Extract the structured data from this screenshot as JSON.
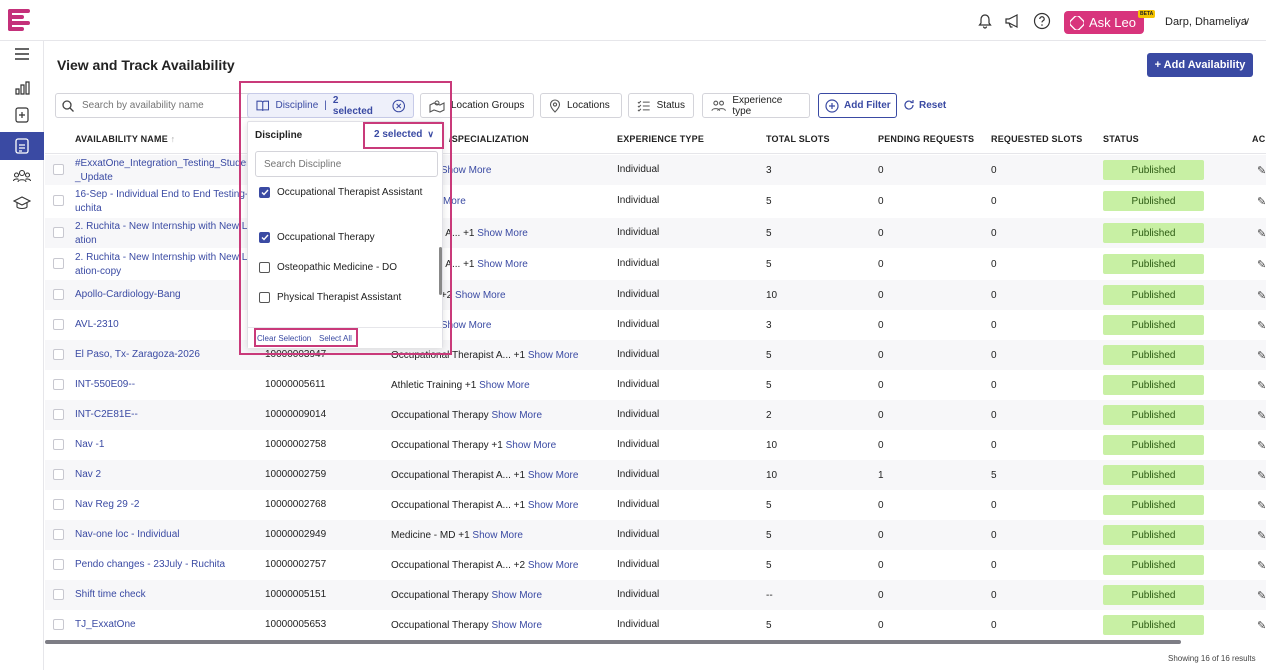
{
  "topbar": {
    "ask_leo_label": "Ask Leo",
    "beta_badge": "BETA",
    "user_name": "Darp, Dhameliya",
    "icons": [
      "bell-icon",
      "megaphone-icon",
      "help-icon"
    ]
  },
  "sidebar": {
    "items": [
      "menu-icon",
      "reports-icon",
      "add-document-icon",
      "availability-icon",
      "users-icon",
      "graduation-icon"
    ],
    "active_index": 3
  },
  "page": {
    "title": "View and Track Availability",
    "add_button": "+ Add Availability"
  },
  "filters": {
    "search_placeholder": "Search by availability name",
    "discipline_label": "Discipline",
    "discipline_count": "2 selected",
    "location_groups": "Location Groups",
    "locations": "Locations",
    "status": "Status",
    "experience_type": "Experience type",
    "add_filter": "Add Filter",
    "reset": "Reset"
  },
  "dropdown": {
    "title": "Discipline",
    "selected_label": "2 selected",
    "search_placeholder": "Search Discipline",
    "options": [
      {
        "label": "Occupational Therapist Assistant",
        "checked": true
      },
      {
        "label": "Occupational Therapy",
        "checked": true
      },
      {
        "label": "Osteopathic Medicine - DO",
        "checked": false
      },
      {
        "label": "Physical Therapist Assistant",
        "checked": false
      }
    ],
    "clear_selection": "Clear Selection",
    "select_all": "Select All"
  },
  "table": {
    "headers": {
      "name": "AVAILABILITY NAME",
      "discipline": "/SPECIALIZATION",
      "experience": "EXPERIENCE TYPE",
      "total_slots": "TOTAL SLOTS",
      "pending": "PENDING REQUESTS",
      "requested": "REQUESTED SLOTS",
      "status": "STATUS",
      "actions": "AC"
    },
    "rows": [
      {
        "name": "#ExxatOne_Integration_Testing_Studen\n_Update",
        "id": "",
        "discipline": "al Therapy",
        "more": "Show More",
        "experience": "Individual",
        "total": "3",
        "pending": "0",
        "requested": "0",
        "status": "Published"
      },
      {
        "name": "16-Sep - Individual End to End Testing-\nuchita",
        "id": "",
        "discipline": "D +2",
        "more": "Show More",
        "experience": "Individual",
        "total": "5",
        "pending": "0",
        "requested": "0",
        "status": "Published"
      },
      {
        "name": "2. Ruchita - New Internship with New Lo\nation",
        "id": "",
        "discipline": "al Therapist A... +1",
        "more": "Show More",
        "experience": "Individual",
        "total": "5",
        "pending": "0",
        "requested": "0",
        "status": "Published"
      },
      {
        "name": "2. Ruchita - New Internship with New Lo\nation-copy",
        "id": "",
        "discipline": "al Therapist A... +1",
        "more": "Show More",
        "experience": "Individual",
        "total": "5",
        "pending": "0",
        "requested": "0",
        "status": "Published"
      },
      {
        "name": "Apollo-Cardiology-Bang",
        "id": "",
        "discipline": "al Therapy +2",
        "more": "Show More",
        "experience": "Individual",
        "total": "10",
        "pending": "0",
        "requested": "0",
        "status": "Published"
      },
      {
        "name": "AVL-2310",
        "id": "",
        "discipline": "al Therapy",
        "more": "Show More",
        "experience": "Individual",
        "total": "3",
        "pending": "0",
        "requested": "0",
        "status": "Published"
      },
      {
        "name": "El Paso, Tx- Zaragoza-2026",
        "id": "10000003947",
        "discipline": "Occupational Therapist A... +1",
        "more": "Show More",
        "experience": "Individual",
        "total": "5",
        "pending": "0",
        "requested": "0",
        "status": "Published"
      },
      {
        "name": "INT-550E09--",
        "id": "10000005611",
        "discipline": "Athletic Training +1",
        "more": "Show More",
        "experience": "Individual",
        "total": "5",
        "pending": "0",
        "requested": "0",
        "status": "Published"
      },
      {
        "name": "INT-C2E81E--",
        "id": "10000009014",
        "discipline": "Occupational Therapy",
        "more": "Show More",
        "experience": "Individual",
        "total": "2",
        "pending": "0",
        "requested": "0",
        "status": "Published"
      },
      {
        "name": "Nav -1",
        "id": "10000002758",
        "discipline": "Occupational Therapy +1",
        "more": "Show More",
        "experience": "Individual",
        "total": "10",
        "pending": "0",
        "requested": "0",
        "status": "Published"
      },
      {
        "name": "Nav 2",
        "id": "10000002759",
        "discipline": "Occupational Therapist A... +1",
        "more": "Show More",
        "experience": "Individual",
        "total": "10",
        "pending": "1",
        "requested": "5",
        "status": "Published"
      },
      {
        "name": "Nav Reg 29 -2",
        "id": "10000002768",
        "discipline": "Occupational Therapist A... +1",
        "more": "Show More",
        "experience": "Individual",
        "total": "5",
        "pending": "0",
        "requested": "0",
        "status": "Published"
      },
      {
        "name": "Nav-one loc - Individual",
        "id": "10000002949",
        "discipline": "Medicine - MD +1",
        "more": "Show More",
        "experience": "Individual",
        "total": "5",
        "pending": "0",
        "requested": "0",
        "status": "Published"
      },
      {
        "name": "Pendo changes - 23July - Ruchita",
        "id": "10000002757",
        "discipline": "Occupational Therapist A... +2",
        "more": "Show More",
        "experience": "Individual",
        "total": "5",
        "pending": "0",
        "requested": "0",
        "status": "Published"
      },
      {
        "name": "Shift time check",
        "id": "10000005151",
        "discipline": "Occupational Therapy",
        "more": "Show More",
        "experience": "Individual",
        "total": "--",
        "pending": "0",
        "requested": "0",
        "status": "Published"
      },
      {
        "name": "TJ_ExxatOne",
        "id": "10000005653",
        "discipline": "Occupational Therapy",
        "more": "Show More",
        "experience": "Individual",
        "total": "5",
        "pending": "0",
        "requested": "0",
        "status": "Published"
      }
    ],
    "footer": "Showing 16 of 16 results"
  },
  "colors": {
    "primary": "#3a4aa3",
    "brand_pink": "#d8347c",
    "status_green": "#c8f0a4",
    "highlight": "#c93a7a"
  }
}
